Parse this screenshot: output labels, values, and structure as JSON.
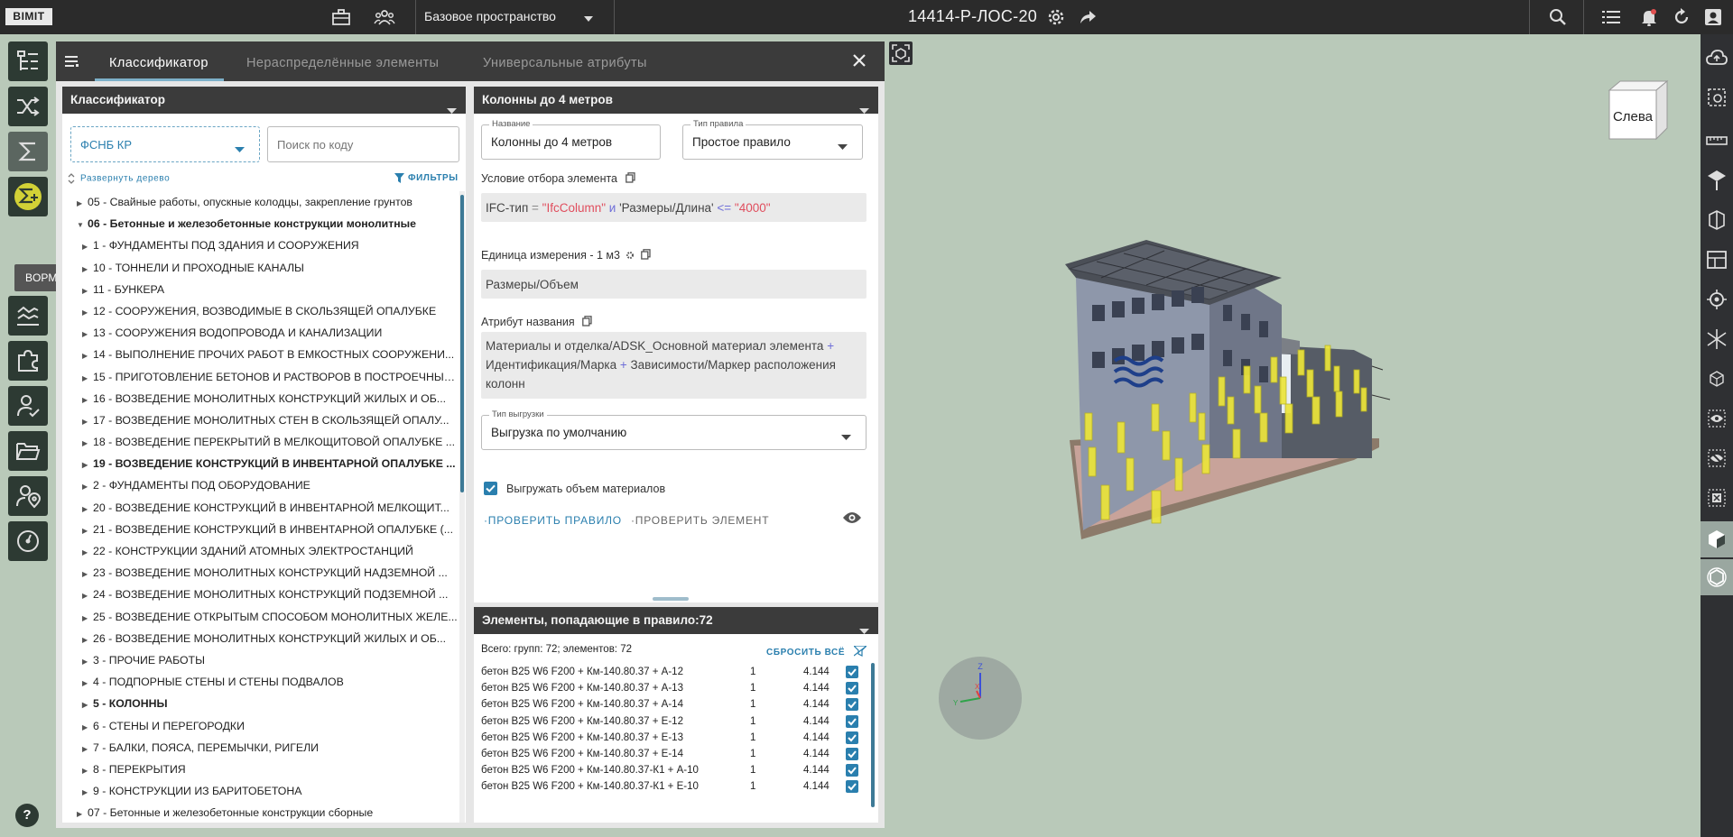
{
  "topbar": {
    "logo": "BIMIT",
    "space": "Базовое пространство",
    "project_title": "14414-Р-ЛОС-20"
  },
  "rail": {
    "tooltip": "BOPM",
    "help": "?"
  },
  "panel": {
    "tabs": [
      {
        "label": "Классификатор"
      },
      {
        "label": "Нераспределённые элементы"
      },
      {
        "label": "Универсальные атрибуты"
      }
    ]
  },
  "classifier": {
    "header": "Классификатор",
    "selected": "ФСНБ КР",
    "search_placeholder": "Поиск по коду",
    "expand_label": "Развернуть дерево",
    "filters_label": "ФИЛЬТРЫ",
    "tree": [
      {
        "label": "05 - Свайные работы, опускные колодцы, закрепление грунтов",
        "level": 1,
        "open": false,
        "bold": false
      },
      {
        "label": "06 - Бетонные и железобетонные конструкции монолитные",
        "level": 1,
        "open": true,
        "bold": true
      },
      {
        "label": "1 - ФУНДАМЕНТЫ ПОД ЗДАНИЯ И СООРУЖЕНИЯ",
        "level": 2,
        "open": false,
        "bold": false
      },
      {
        "label": "10 - ТОННЕЛИ И ПРОХОДНЫЕ КАНАЛЫ",
        "level": 2,
        "open": false,
        "bold": false
      },
      {
        "label": "11 - БУНКЕРА",
        "level": 2,
        "open": false,
        "bold": false
      },
      {
        "label": "12 - СООРУЖЕНИЯ, ВОЗВОДИМЫЕ В СКОЛЬЗЯЩЕЙ ОПАЛУБКЕ",
        "level": 2,
        "open": false,
        "bold": false
      },
      {
        "label": "13 - СООРУЖЕНИЯ ВОДОПРОВОДА И КАНАЛИЗАЦИИ",
        "level": 2,
        "open": false,
        "bold": false
      },
      {
        "label": "14 - ВЫПОЛНЕНИЕ ПРОЧИХ РАБОТ В ЕМКОСТНЫХ СООРУЖЕНИ...",
        "level": 2,
        "open": false,
        "bold": false
      },
      {
        "label": "15 - ПРИГОТОВЛЕНИЕ БЕТОНОВ И РАСТВОРОВ В ПОСТРОЕЧНЫХ...",
        "level": 2,
        "open": false,
        "bold": false
      },
      {
        "label": "16 - ВОЗВЕДЕНИЕ МОНОЛИТНЫХ КОНСТРУКЦИЙ ЖИЛЫХ И ОБ...",
        "level": 2,
        "open": false,
        "bold": false
      },
      {
        "label": "17 - ВОЗВЕДЕНИЕ МОНОЛИТНЫХ СТЕН В СКОЛЬЗЯЩЕЙ ОПАЛУ...",
        "level": 2,
        "open": false,
        "bold": false
      },
      {
        "label": "18 - ВОЗВЕДЕНИЕ ПЕРЕКРЫТИЙ В МЕЛКОЩИТОВОЙ ОПАЛУБКЕ ...",
        "level": 2,
        "open": false,
        "bold": false
      },
      {
        "label": "19 - ВОЗВЕДЕНИЕ КОНСТРУКЦИЙ В ИНВЕНТАРНОЙ ОПАЛУБКЕ ...",
        "level": 2,
        "open": false,
        "bold": true
      },
      {
        "label": "2 - ФУНДАМЕНТЫ ПОД ОБОРУДОВАНИЕ",
        "level": 2,
        "open": false,
        "bold": false
      },
      {
        "label": "20 - ВОЗВЕДЕНИЕ КОНСТРУКЦИЙ В ИНВЕНТАРНОЙ МЕЛКОЩИТ...",
        "level": 2,
        "open": false,
        "bold": false
      },
      {
        "label": "21 - ВОЗВЕДЕНИЕ КОНСТРУКЦИЙ В ИНВЕНТАРНОЙ ОПАЛУБКЕ (...",
        "level": 2,
        "open": false,
        "bold": false
      },
      {
        "label": "22 - КОНСТРУКЦИИ ЗДАНИЙ АТОМНЫХ ЭЛЕКТРОСТАНЦИЙ",
        "level": 2,
        "open": false,
        "bold": false
      },
      {
        "label": "23 - ВОЗВЕДЕНИЕ МОНОЛИТНЫХ КОНСТРУКЦИЙ НАДЗЕМНОЙ ...",
        "level": 2,
        "open": false,
        "bold": false
      },
      {
        "label": "24 - ВОЗВЕДЕНИЕ МОНОЛИТНЫХ КОНСТРУКЦИЙ ПОДЗЕМНОЙ ...",
        "level": 2,
        "open": false,
        "bold": false
      },
      {
        "label": "25 - ВОЗВЕДЕНИЕ ОТКРЫТЫМ СПОСОБОМ МОНОЛИТНЫХ ЖЕЛЕ...",
        "level": 2,
        "open": false,
        "bold": false
      },
      {
        "label": "26 - ВОЗВЕДЕНИЕ МОНОЛИТНЫХ КОНСТРУКЦИЙ ЖИЛЫХ И ОБ...",
        "level": 2,
        "open": false,
        "bold": false
      },
      {
        "label": "3 - ПРОЧИЕ РАБОТЫ",
        "level": 2,
        "open": false,
        "bold": false
      },
      {
        "label": "4 - ПОДПОРНЫЕ СТЕНЫ И СТЕНЫ ПОДВАЛОВ",
        "level": 2,
        "open": false,
        "bold": false
      },
      {
        "label": "5 - КОЛОННЫ",
        "level": 2,
        "open": false,
        "bold": true
      },
      {
        "label": "6 - СТЕНЫ И ПЕРЕГОРОДКИ",
        "level": 2,
        "open": false,
        "bold": false
      },
      {
        "label": "7 - БАЛКИ, ПОЯСА, ПЕРЕМЫЧКИ, РИГЕЛИ",
        "level": 2,
        "open": false,
        "bold": false
      },
      {
        "label": "8 - ПЕРЕКРЫТИЯ",
        "level": 2,
        "open": false,
        "bold": false
      },
      {
        "label": "9 - КОНСТРУКЦИИ ИЗ БАРИТОБЕТОНА",
        "level": 2,
        "open": false,
        "bold": false
      },
      {
        "label": "07 - Бетонные и железобетонные конструкции сборные",
        "level": 1,
        "open": false,
        "bold": false
      }
    ]
  },
  "rule": {
    "header": "Колонны до 4 метров",
    "name_label": "Название",
    "name_value": "Колонны до 4 метров",
    "type_label": "Тип правила",
    "type_value": "Простое правило",
    "condition_label": "Условие отбора элемента",
    "condition": {
      "p1": "IFC-тип",
      "op1": " = ",
      "v1": "\"IfcColumn\"",
      "and": " и ",
      "p2": "'Размеры/Длина'",
      "op2": " <= ",
      "v2": "\"4000\""
    },
    "unit_label": "Единица измерения - 1 м3",
    "unit_value": "Размеры/Объем",
    "attr_label": "Атрибут названия",
    "attr": {
      "a1": "Материалы и отделка/ADSK_Основной материал элемента",
      "plus1": " + ",
      "a2": "Идентификация/Марка",
      "plus2": " + ",
      "a3": "Зависимости/Маркер расположения колонн"
    },
    "export_label": "Тип выгрузки",
    "export_value": "Выгрузка по умолчанию",
    "export_volume_label": "Выгружать объем материалов",
    "check_rule": "ПРОВЕРИТЬ ПРАВИЛО",
    "check_element": "ПРОВЕРИТЬ ЭЛЕМЕНТ"
  },
  "elements": {
    "header": "Элементы, попадающие в правило:72",
    "summary": "Всего: групп: 72; элементов: 72",
    "reset_label": "СБРОСИТЬ ВСЁ",
    "rows": [
      {
        "name": "бетон B25 W6 F200 + Км-140.80.37 + А-12",
        "qty": "1",
        "value": "4.144"
      },
      {
        "name": "бетон B25 W6 F200 + Км-140.80.37 + А-13",
        "qty": "1",
        "value": "4.144"
      },
      {
        "name": "бетон B25 W6 F200 + Км-140.80.37 + А-14",
        "qty": "1",
        "value": "4.144"
      },
      {
        "name": "бетон B25 W6 F200 + Км-140.80.37 + Е-12",
        "qty": "1",
        "value": "4.144"
      },
      {
        "name": "бетон B25 W6 F200 + Км-140.80.37 + Е-13",
        "qty": "1",
        "value": "4.144"
      },
      {
        "name": "бетон B25 W6 F200 + Км-140.80.37 + Е-14",
        "qty": "1",
        "value": "4.144"
      },
      {
        "name": "бетон B25 W6 F200 + Км-140.80.37-К1 + А-10",
        "qty": "1",
        "value": "4.144"
      },
      {
        "name": "бетон B25 W6 F200 + Км-140.80.37-К1 + Е-10",
        "qty": "1",
        "value": "4.144"
      }
    ]
  },
  "viewport": {
    "cube_face": "Слева",
    "axis_z": "Z",
    "axis_x": "X",
    "axis_y": "Y"
  },
  "colors": {
    "accent": "#2a7fae",
    "highlight": "#e8e23a",
    "dark": "#2b2b2b"
  }
}
